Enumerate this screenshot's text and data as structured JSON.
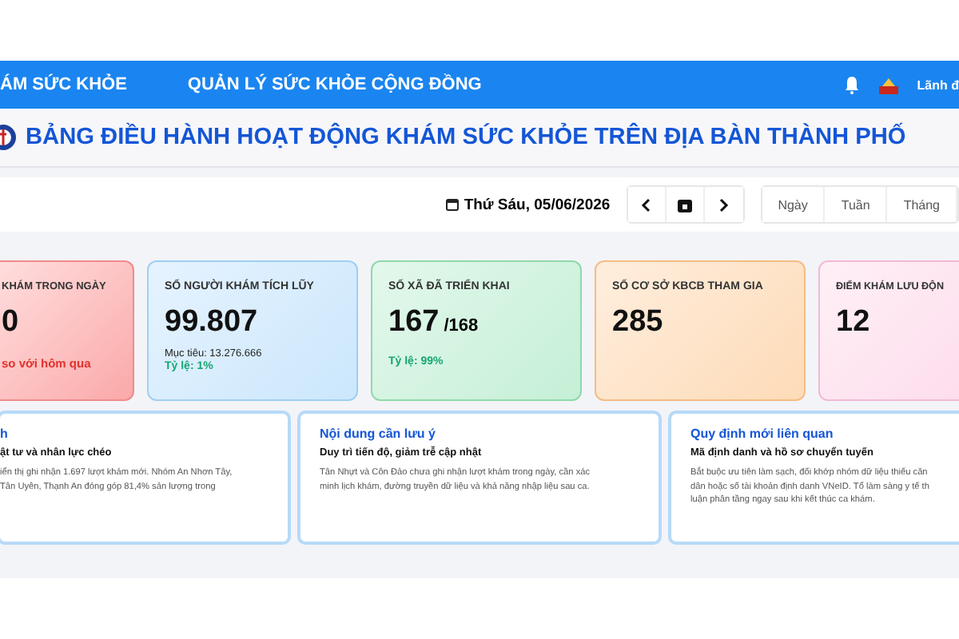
{
  "nav": {
    "items": [
      {
        "label": "ÁM SỨC KHỎE"
      },
      {
        "label": "QUẢN LÝ SỨC KHỎE CỘNG ĐỒNG"
      }
    ],
    "user": "Lãnh đ"
  },
  "title": "BẢNG ĐIỀU HÀNH HOẠT ĐỘNG KHÁM SỨC KHỎE TRÊN ĐỊA BÀN THÀNH PHỐ",
  "toolbar": {
    "date": "Thứ Sáu, 05/06/2026",
    "periods": [
      {
        "label": "Ngày",
        "selected": false
      },
      {
        "label": "Tuần",
        "selected": false
      },
      {
        "label": "Tháng",
        "selected": false
      }
    ]
  },
  "stats": [
    {
      "kind": "red",
      "label": "KHÁM TRONG NGÀY",
      "value": "0",
      "note": "so với hôm qua"
    },
    {
      "kind": "blue",
      "label": "SỐ NGƯỜI KHÁM TÍCH LŨY",
      "value": "99.807",
      "target": "Mục tiêu: 13.276.666",
      "rate": "Tỷ lệ: 1%"
    },
    {
      "kind": "green",
      "label": "SỐ XÃ ĐÃ TRIỂN KHAI",
      "value": "167",
      "total": "/168",
      "rate": "Tỷ lệ: 99%"
    },
    {
      "kind": "orange",
      "label": "SỐ CƠ SỞ KBCB THAM GIA",
      "value": "285"
    },
    {
      "kind": "pink",
      "label": "ĐIỂM KHÁM LƯU ĐỘN",
      "value": "12"
    }
  ],
  "notices": [
    {
      "title": "h",
      "subtitle": "ật tư và nhân lực chéo",
      "lines": [
        "iển thị ghi nhận 1.697 lượt khám mới. Nhóm An Nhơn Tây,",
        "Tân Uyên, Thạnh An đóng góp 81,4% sản lượng trong"
      ]
    },
    {
      "title": "Nội dung cần lưu ý",
      "subtitle": "Duy trì tiến độ, giảm trễ cập nhật",
      "lines": [
        "Tân Nhựt và Côn Đảo chưa ghi nhận lượt khám trong ngày, cần xác",
        "minh lịch khám, đường truyền dữ liệu và khả năng nhập liệu sau ca."
      ]
    },
    {
      "title": "Quy định mới liên quan",
      "subtitle": "Mã định danh và hồ sơ chuyển tuyến",
      "lines": [
        "Bắt buộc ưu tiên làm sạch, đối khớp nhóm dữ liệu thiếu căn",
        "dân hoặc số tài khoản định danh VNeID. Tổ làm sàng y tế th",
        "luận phân tầng ngay sau khi kết thúc ca khám."
      ]
    }
  ]
}
